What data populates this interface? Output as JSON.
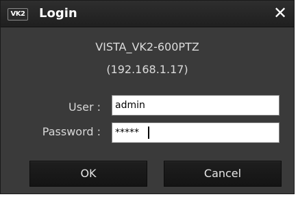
{
  "window": {
    "logo_text": "VK2",
    "title": "Login",
    "close_glyph": "✕"
  },
  "device": {
    "name": "VISTA_VK2-600PTZ",
    "ip": "(192.168.1.17)"
  },
  "form": {
    "user_label": "User :",
    "user_value": "admin",
    "password_label": "Password :",
    "password_value": "*****"
  },
  "buttons": {
    "ok_label": "OK",
    "cancel_label": "Cancel"
  },
  "colors": {
    "dialog_bg": "#3a3a3a",
    "titlebar_bg": "#1f1f1f",
    "button_bg": "#161616",
    "text_light": "#dcdcdc"
  }
}
